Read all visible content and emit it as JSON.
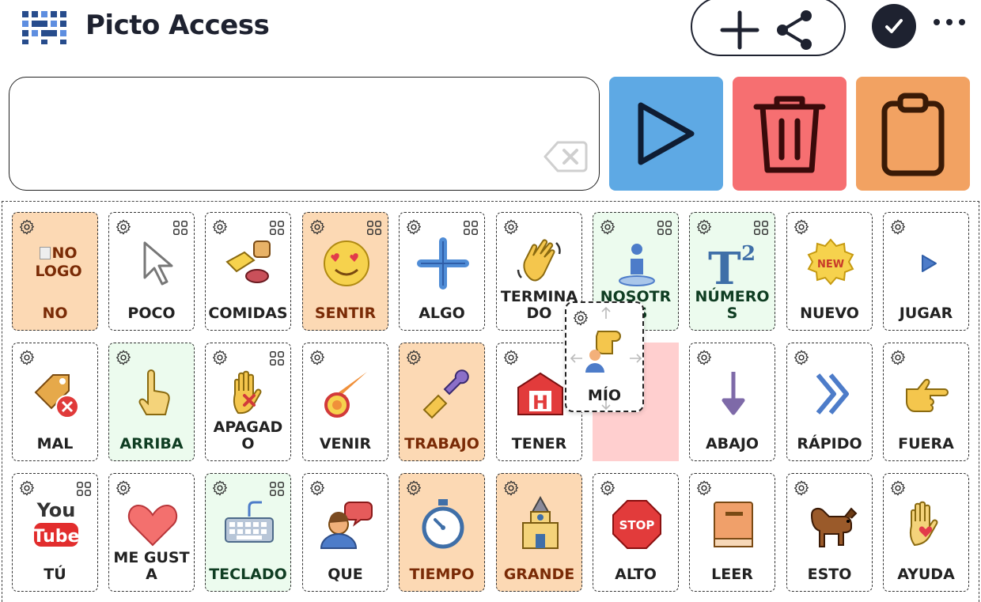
{
  "header": {
    "title": "Picto Access"
  },
  "colors": {
    "play": "#5ea9e4",
    "delete": "#f66f71",
    "copy": "#f2a262",
    "orange_tile": "#fcd9b4",
    "green_tile": "#ecfbee",
    "dark": "#1e2230"
  },
  "icons": {
    "logo": "grid-logo-icon",
    "pill": [
      "plus-icon",
      "share-icon"
    ],
    "check": "check-icon",
    "more": "more-dots-icon",
    "input": "backspace-icon",
    "actions": [
      "play-icon",
      "trash-icon",
      "clipboard-icon"
    ]
  },
  "tiles": [
    {
      "label": "NO",
      "color": "orange",
      "icon": "broken-image-icon",
      "alt": "NO LOGO"
    },
    {
      "label": "POCO",
      "color": "white",
      "icon": "cursor-icon"
    },
    {
      "label": "COMIDAS",
      "color": "white",
      "icon": "food-icon"
    },
    {
      "label": "SENTIR",
      "color": "orange",
      "icon": "heart-eyes-icon"
    },
    {
      "label": "ALGO",
      "color": "white",
      "icon": "plus-icon"
    },
    {
      "label": "TERMINADO",
      "color": "white",
      "icon": "waving-hand-icon"
    },
    {
      "label": "NOSOTROS",
      "color": "green",
      "icon": "person-standing-icon"
    },
    {
      "label": "NÚMEROS",
      "color": "green",
      "icon": "superscript-icon"
    },
    {
      "label": "NUEVO",
      "color": "white",
      "icon": "new-badge-icon"
    },
    {
      "label": "JUGAR",
      "color": "white",
      "icon": "play-small-icon"
    },
    {
      "label": "MAL",
      "color": "white",
      "icon": "tag-remove-icon"
    },
    {
      "label": "ARRIBA",
      "color": "green",
      "icon": "pointing-up-icon"
    },
    {
      "label": "APAGADO",
      "color": "white",
      "icon": "hand-x-icon"
    },
    {
      "label": "VENIR",
      "color": "white",
      "icon": "comet-icon"
    },
    {
      "label": "TRABAJO",
      "color": "orange",
      "icon": "wrench-hand-icon"
    },
    {
      "label": "TENER",
      "color": "white",
      "icon": "hospital-icon"
    },
    {
      "label": "",
      "color": "white",
      "icon": ""
    },
    {
      "label": "ABAJO",
      "color": "white",
      "icon": "arrow-down-icon"
    },
    {
      "label": "RÁPIDO",
      "color": "white",
      "icon": "double-chevron-icon"
    },
    {
      "label": "FUERA",
      "color": "white",
      "icon": "pointing-right-icon"
    },
    {
      "label": "TÚ",
      "color": "white",
      "icon": "youtube-icon"
    },
    {
      "label": "ME GUSTA",
      "color": "white",
      "icon": "heart-icon"
    },
    {
      "label": "TECLADO",
      "color": "green",
      "icon": "keyboard-icon"
    },
    {
      "label": "QUE",
      "color": "white",
      "icon": "speaking-person-icon"
    },
    {
      "label": "TIEMPO",
      "color": "orange",
      "icon": "stopwatch-icon"
    },
    {
      "label": "GRANDE",
      "color": "orange",
      "icon": "tower-icon"
    },
    {
      "label": "ALTO",
      "color": "white",
      "icon": "stop-sign-icon"
    },
    {
      "label": "LEER",
      "color": "white",
      "icon": "book-icon"
    },
    {
      "label": "ESTO",
      "color": "white",
      "icon": "dog-icon"
    },
    {
      "label": "AYUDA",
      "color": "white",
      "icon": "hand-heart-icon"
    }
  ],
  "dragging": {
    "label": "MÍO",
    "icon": "pointing-person-icon",
    "badge": "NEW",
    "stop": "STOP",
    "youtube_top": "You",
    "youtube_bottom": "Tube",
    "h": "H"
  }
}
